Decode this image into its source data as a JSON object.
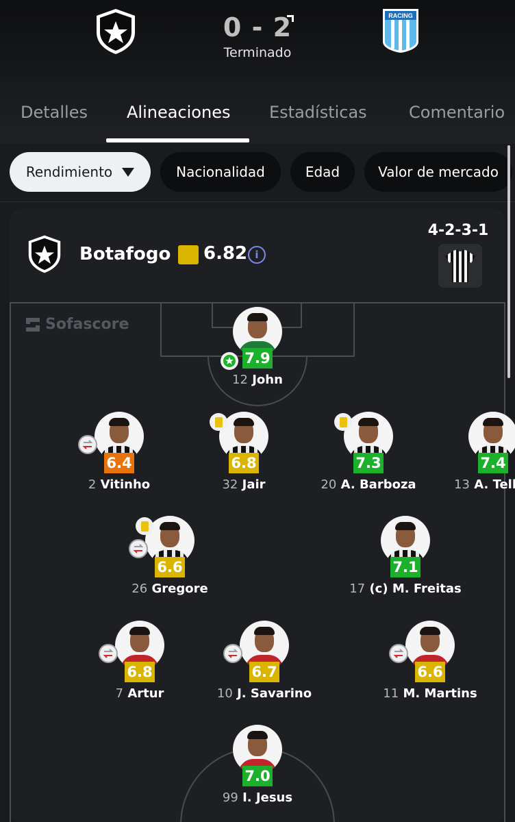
{
  "match": {
    "home_score": "0",
    "separator": "-",
    "away_score": "2",
    "status": "Terminado",
    "home_crest_icon": "botafogo-star-crest",
    "away_crest_icon": "racing-crest",
    "away_crest_text": "RACING"
  },
  "tabs": [
    {
      "label": "Detalles",
      "active": false
    },
    {
      "label": "Alineaciones",
      "active": true
    },
    {
      "label": "Estadísticas",
      "active": false
    },
    {
      "label": "Comentario",
      "active": false
    }
  ],
  "chips": [
    {
      "label": "Rendimiento",
      "selected": true
    },
    {
      "label": "Nacionalidad",
      "selected": false
    },
    {
      "label": "Edad",
      "selected": false
    },
    {
      "label": "Valor de mercado",
      "selected": false
    }
  ],
  "team": {
    "name": "Botafogo",
    "rating": "6.82",
    "formation": "4-2-3-1",
    "info_icon": "i"
  },
  "watermark": "Sofascore",
  "colors": {
    "rating_green": "#1db02d",
    "rating_yellow": "#d9b400",
    "rating_orange": "#e8730c",
    "accent_info": "#7b86e8"
  },
  "players": [
    {
      "number": "12",
      "name": "John",
      "rating": "7.9",
      "tier": "green",
      "motm": true,
      "sub": false,
      "yellow": false
    },
    {
      "number": "2",
      "name": "Vitinho",
      "rating": "6.4",
      "tier": "orange",
      "motm": false,
      "sub": true,
      "yellow": false
    },
    {
      "number": "32",
      "name": "Jair",
      "rating": "6.8",
      "tier": "yellow",
      "motm": false,
      "sub": false,
      "yellow": true
    },
    {
      "number": "20",
      "name": "A. Barboza",
      "rating": "7.3",
      "tier": "green",
      "motm": false,
      "sub": false,
      "yellow": true
    },
    {
      "number": "13",
      "name": "A. Telles",
      "rating": "7.4",
      "tier": "green",
      "motm": false,
      "sub": false,
      "yellow": false
    },
    {
      "number": "26",
      "name": "Gregore",
      "rating": "6.6",
      "tier": "yellow",
      "motm": false,
      "sub": true,
      "yellow": true
    },
    {
      "number": "17",
      "name": "(c) M. Freitas",
      "rating": "7.1",
      "tier": "green",
      "motm": false,
      "sub": false,
      "yellow": false
    },
    {
      "number": "7",
      "name": "Artur",
      "rating": "6.8",
      "tier": "yellow",
      "motm": false,
      "sub": true,
      "yellow": false
    },
    {
      "number": "10",
      "name": "J. Savarino",
      "rating": "6.7",
      "tier": "yellow",
      "motm": false,
      "sub": true,
      "yellow": false
    },
    {
      "number": "11",
      "name": "M. Martins",
      "rating": "6.6",
      "tier": "yellow",
      "motm": false,
      "sub": true,
      "yellow": false
    },
    {
      "number": "99",
      "name": "I. Jesus",
      "rating": "7.0",
      "tier": "green",
      "motm": false,
      "sub": false,
      "yellow": false
    }
  ]
}
